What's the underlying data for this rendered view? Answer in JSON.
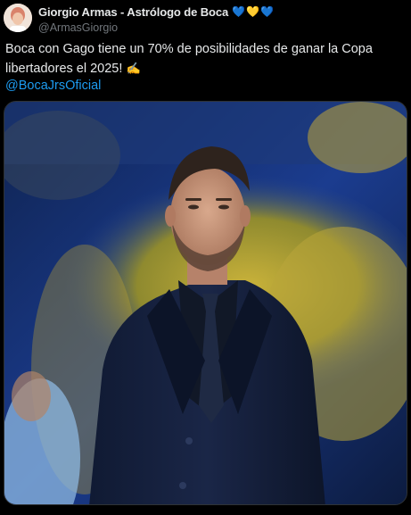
{
  "author": {
    "display_name": "Giorgio Armas - Astrólogo de Boca",
    "hearts": [
      "💙",
      "💛",
      "💙"
    ],
    "handle": "@ArmasGiorgio",
    "avatar": "avatar-photo"
  },
  "tweet": {
    "text": "Boca con Gago tiene un 70% de posibilidades de ganar la Copa libertadores el 2025!",
    "emoji": "✍️",
    "mention": "@BocaJrsOficial"
  },
  "media": {
    "kind": "photo",
    "subject": "man-in-dark-suit-photo"
  },
  "colors": {
    "background": "#000000",
    "text": "#e7e9ea",
    "secondary": "#71767b",
    "link": "#1d9bf0",
    "boca_blue": "#1b3f9a",
    "boca_yellow": "#f6c02b"
  }
}
